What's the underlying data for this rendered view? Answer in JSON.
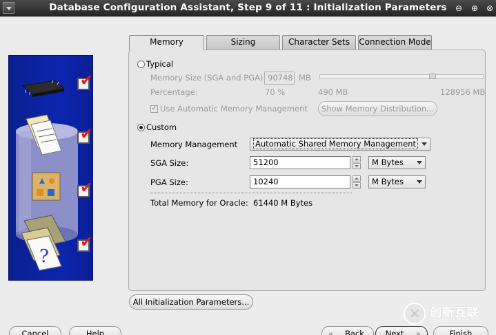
{
  "window": {
    "title": "Database Configuration Assistant, Step 9 of 11 : Initialization Parameters",
    "menu_icon": "window-menu-icon",
    "minimize_glyph": "⊖",
    "maximize_glyph": "⊕",
    "close_glyph": "⊗"
  },
  "tabs": [
    {
      "label": "Memory",
      "active": true
    },
    {
      "label": "Sizing",
      "active": false
    },
    {
      "label": "Character Sets",
      "active": false
    },
    {
      "label": "Connection Mode",
      "active": false
    }
  ],
  "typical": {
    "label": "Typical",
    "selected": false,
    "memory_size_label": "Memory Size (SGA and PGA):",
    "memory_size_value": "90748",
    "memory_size_unit": "MB",
    "percentage_label": "Percentage:",
    "percentage_value": "70 %",
    "slider_min": "490 MB",
    "slider_max": "128956 MB",
    "amm_label": "Use Automatic Memory Management",
    "amm_checked": true,
    "show_distribution_label": "Show Memory Distribution..."
  },
  "custom": {
    "label": "Custom",
    "selected": true,
    "memory_management_label": "Memory Management",
    "memory_management_value": "Automatic Shared Memory Management",
    "sga_label": "SGA Size:",
    "sga_value": "51200",
    "sga_unit": "M Bytes",
    "pga_label": "PGA Size:",
    "pga_value": "10240",
    "pga_unit": "M Bytes",
    "total_label": "Total Memory for Oracle:",
    "total_value": "61440 M Bytes"
  },
  "all_params_label": "All Initialization Parameters...",
  "footer": {
    "cancel": "Cancel",
    "help": "Help",
    "back": "Back",
    "next": "Next",
    "finish": "Finish"
  },
  "watermark": {
    "cn": "创新互联",
    "en": "CHUANG XIN HU LIAN"
  },
  "colors": {
    "panel_blue": "#0c25b0",
    "check_red": "#e01b1b",
    "titlebar": "#2f2f2f"
  }
}
